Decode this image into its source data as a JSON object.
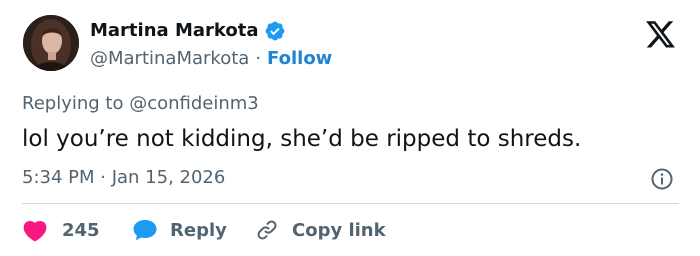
{
  "author": {
    "display_name": "Martina Markota",
    "handle": "@MartinaMarkota",
    "separator": "·",
    "follow_label": "Follow"
  },
  "tweet": {
    "replying_to": "Replying to @confideinm3",
    "text": "lol you’re not kidding, she’d be ripped to shreds.",
    "timestamp": "5:34 PM · Jan 15, 2026"
  },
  "actions": {
    "like_count": "245",
    "reply_label": "Reply",
    "copy_link_label": "Copy link"
  },
  "colors": {
    "verified": "#1d9bf0",
    "like": "#f91880",
    "reply": "#1d9bf0",
    "follow": "#1d84d6",
    "secondary_text": "#536471"
  },
  "icons": {
    "verified": "verified-badge-icon",
    "logo": "x-logo-icon",
    "info": "info-icon",
    "like": "heart-icon",
    "reply": "speech-bubble-icon",
    "copy_link": "link-icon"
  }
}
